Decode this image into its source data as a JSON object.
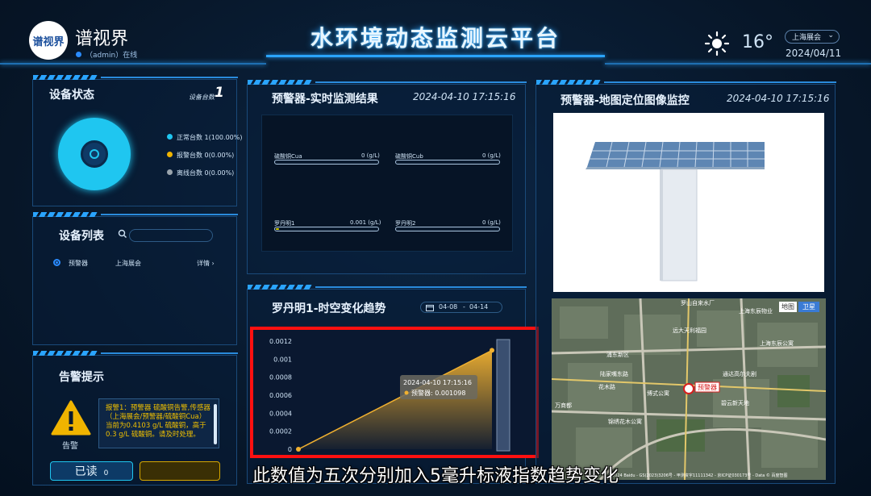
{
  "brand": {
    "logo_text": "谱视界",
    "name": "谱视界",
    "user_status": "（admin）在线"
  },
  "header": {
    "title": "水环境动态监测云平台",
    "temperature": "16°",
    "city": "上海展会",
    "date": "2024/04/11"
  },
  "device_status": {
    "title": "设备状态",
    "count_label": "设备台数",
    "count": "1",
    "legend": [
      {
        "text": "正常台数 1(100.00%)",
        "color": "#1fc6f0"
      },
      {
        "text": "报警台数 0(0.00%)",
        "color": "#f0b400"
      },
      {
        "text": "离线台数 0(0.00%)",
        "color": "#9aa4ad"
      }
    ]
  },
  "device_list": {
    "title": "设备列表",
    "rows": [
      {
        "name": "预警器",
        "location": "上海展会",
        "action": "详情"
      }
    ]
  },
  "alarm": {
    "title": "告警提示",
    "icon_label": "告警",
    "message": "报警1：预警器 硫酸铜告警,传感器（上海展会/预警器/硫酸铜Cua） 当前为0.4103 g/L 硫酸铜，高于0.3 g/L 硫酸铜。请及时处理。",
    "read_label": "已读",
    "read_count": "0",
    "unread_label": ""
  },
  "realtime": {
    "title": "预警器-实时监测结果",
    "time": "2024-04-10 17:15:16",
    "items": [
      {
        "name": "硫酸铜Cua",
        "value": "0 (g/L)",
        "level": 0
      },
      {
        "name": "硫酸铜Cub",
        "value": "0 (g/L)",
        "level": 0
      },
      {
        "name": "罗丹明1",
        "value": "0.001 (g/L)",
        "level": 0.03
      },
      {
        "name": "罗丹明2",
        "value": "0 (g/L)",
        "level": 0
      }
    ]
  },
  "trend": {
    "title": "罗丹明1-时空变化趋势",
    "date_start": "04-08",
    "date_sep": "-",
    "date_end": "04-14",
    "tooltip_time": "2024-04-10 17:15:16",
    "tooltip_value": "预警器: 0.001098"
  },
  "chart_data": {
    "type": "area",
    "x": [
      0,
      1
    ],
    "series": [
      {
        "name": "预警器",
        "values": [
          0,
          0.001098
        ]
      }
    ],
    "ylim": [
      0,
      0.0012
    ],
    "yticks": [
      "0",
      "0.0002",
      "0.0004",
      "0.0006",
      "0.0008",
      "0.001",
      "0.0012"
    ],
    "color": "#f0b030"
  },
  "map_panel": {
    "title": "预警器-地图定位图像监控",
    "time": "2024-04-10 17:15:16",
    "map_btn_map": "地图",
    "map_btn_sat": "卫星",
    "marker_label": "预警器",
    "place_labels": [
      "罗山自来水厂",
      "远大天利福园",
      "上海东辰公寓",
      "花木路",
      "博式公寓",
      "陆家嘴东路",
      "通达高尔夫剧",
      "万商都",
      "碧云新天地",
      "锦绣花木公寓",
      "浦东新区",
      "上海东辰物业"
    ],
    "copyright": "©2024 Baidu - GS(2023)3206号 - 甲测资字11111342 - 京ICP证030173号 - Data © 百度智图"
  },
  "subtitle": "此数值为五次分别加入5毫升标液指数趋势变化"
}
